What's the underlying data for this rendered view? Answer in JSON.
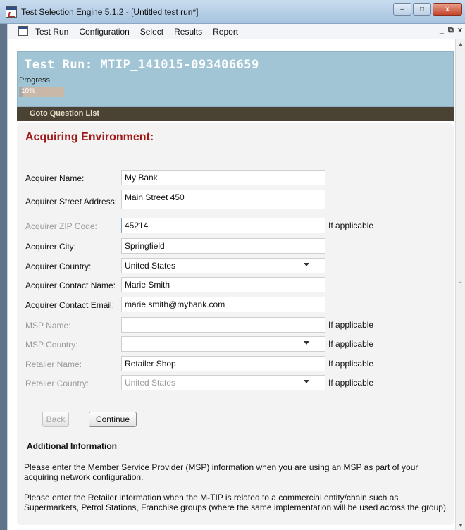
{
  "window": {
    "title": "Test Selection Engine 5.1.2 - [Untitled test run*]",
    "controls": [
      "–",
      "□",
      "x"
    ]
  },
  "menubar": {
    "items": [
      "Test Run",
      "Configuration",
      "Select",
      "Results",
      "Report"
    ],
    "mdi_controls": [
      "_",
      "⧉",
      "x"
    ]
  },
  "header": {
    "run_title": "Test Run: MTIP_141015-093406659",
    "progress_label": "Progress:",
    "progress_text": "10%",
    "progress_value": 0.1,
    "goto_label": "Goto Question List"
  },
  "section": {
    "title": "Acquiring Environment:"
  },
  "form": {
    "acquirer_name": {
      "label": "Acquirer Name:",
      "value": "My Bank"
    },
    "acquirer_street": {
      "label": "Acquirer Street Address:",
      "value": "Main Street 450"
    },
    "acquirer_zip": {
      "label": "Acquirer ZIP Code:",
      "value": "45214",
      "note": "If applicable"
    },
    "acquirer_city": {
      "label": "Acquirer City:",
      "value": "Springfield"
    },
    "acquirer_country": {
      "label": "Acquirer Country:",
      "value": "United States"
    },
    "acquirer_contact_name": {
      "label": "Acquirer Contact Name:",
      "value": "Marie Smith"
    },
    "acquirer_contact_email": {
      "label": "Acquirer Contact Email:",
      "value": "marie.smith@mybank.com"
    },
    "msp_name": {
      "label": "MSP Name:",
      "value": "",
      "note": "If applicable"
    },
    "msp_country": {
      "label": "MSP Country:",
      "value": "",
      "note": "If applicable"
    },
    "retailer_name": {
      "label": "Retailer Name:",
      "value": "Retailer Shop",
      "note": "If applicable"
    },
    "retailer_country": {
      "label": "Retailer Country:",
      "value": "United States",
      "note": "If applicable"
    }
  },
  "buttons": {
    "back": "Back",
    "continue": "Continue"
  },
  "additional": {
    "title": "Additional Information",
    "para1": "Please enter the Member Service Provider (MSP) information when you are using an MSP as part of your acquiring network configuration.",
    "para2": "Please enter the Retailer information when the M-TIP is related to a commercial entity/chain such as Supermarkets, Petrol Stations, Franchise groups (where the same implementation will be used across the group)."
  },
  "colors": {
    "header_band": "#a2c5d6",
    "nav_band": "#4a4233",
    "section_title": "#a01818"
  }
}
